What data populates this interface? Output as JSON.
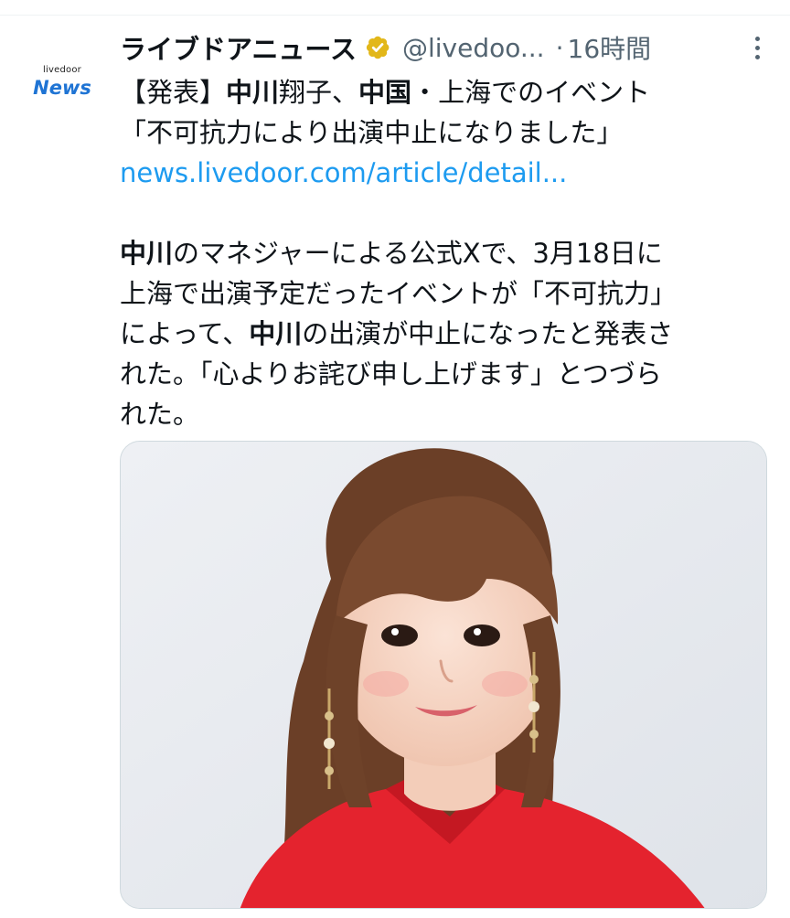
{
  "tweet": {
    "avatar": {
      "logo_small": "livedoor",
      "logo_big": "News"
    },
    "author": {
      "display_name": "ライブドアニュース",
      "handle": "@livedoo...",
      "verified_badge_color": "#e2b719"
    },
    "separator": "·",
    "timestamp": "16時間",
    "more_icon": "more-vertical-icon",
    "text": {
      "line1_pre": "【発表】",
      "line1_b1": "中川",
      "line1_mid": "翔子、",
      "line1_b2": "中国",
      "line1_post": "・上海でのイベント",
      "line2": "「不可抗力により出演中止になりました」",
      "link": "news.livedoor.com/article/detail...",
      "line4_b": "中川",
      "line4_post": "のマネジャーによる公式Xで、3月18日に",
      "line5": "上海で出演予定だったイベントが「不可抗力」",
      "line6_pre": "によって、",
      "line6_b": "中川",
      "line6_post": "の出演が中止になったと発表さ",
      "line7": "れた。「心よりお詫び申し上げます」とつづら",
      "line8": "れた。"
    },
    "colors": {
      "link": "#1d9bf0",
      "secondary_text": "#536471",
      "primary_text": "#0f1419"
    }
  }
}
